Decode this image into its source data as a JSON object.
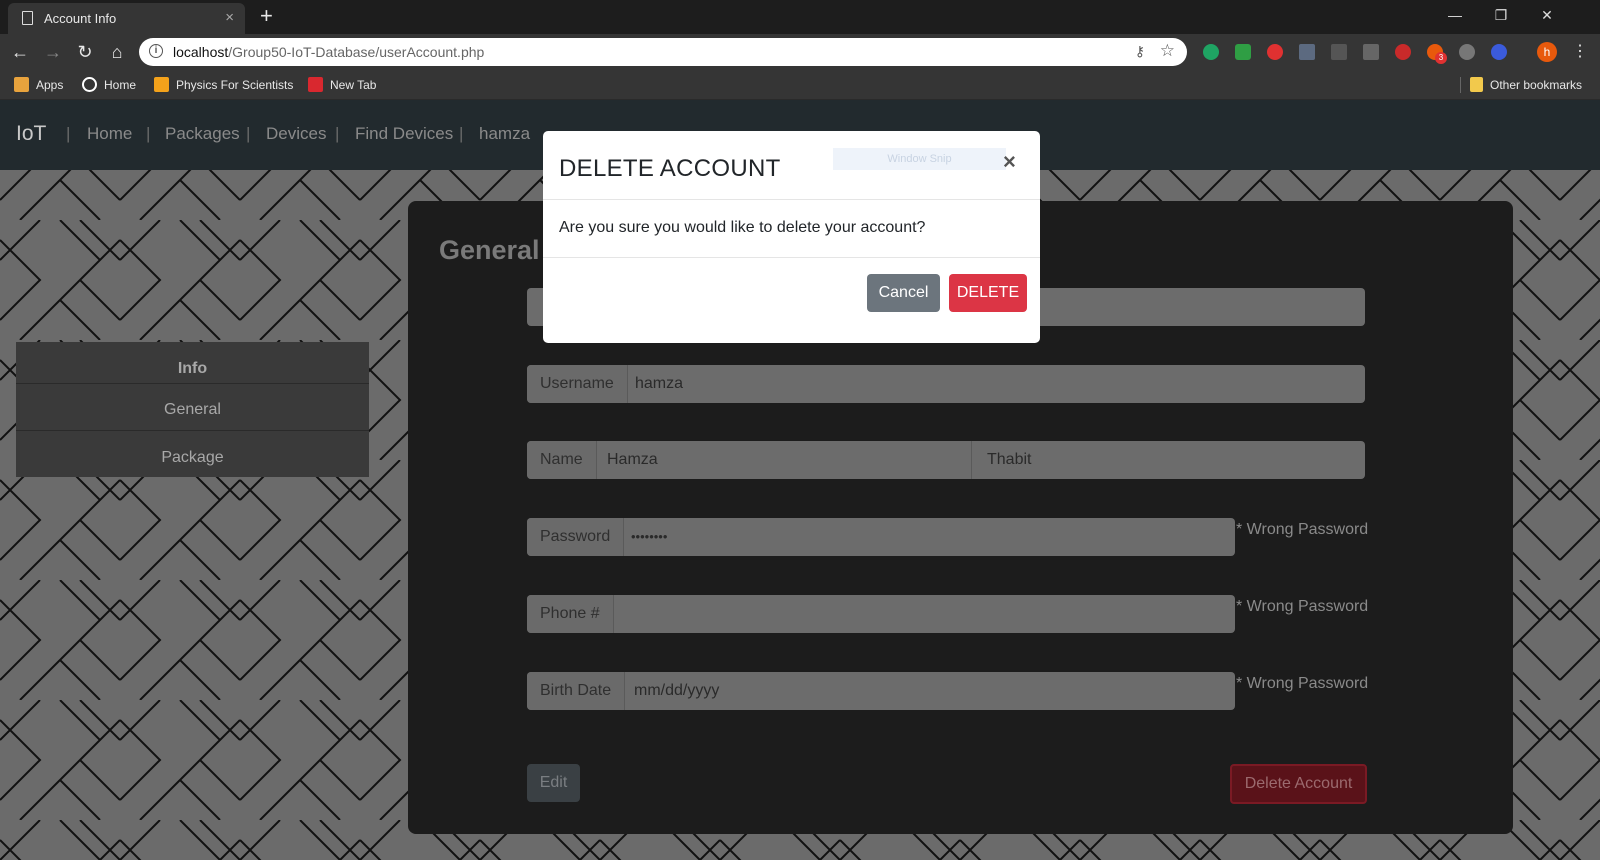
{
  "browser": {
    "tab_title": "Account Info",
    "tab_close": "×",
    "new_tab": "+",
    "url_host": "localhost",
    "url_path": "/Group50-IoT-Database/userAccount.php",
    "bookmarks": [
      {
        "label": "Apps",
        "color": "#e8a33d"
      },
      {
        "label": "Home",
        "color": "#ffffff"
      },
      {
        "label": "Physics For Scientists",
        "color": "#f4a21b"
      },
      {
        "label": "New Tab",
        "color": "#d9282f"
      }
    ],
    "other_bookmarks": "Other bookmarks",
    "ext_badge": "3",
    "profile_initial": "h"
  },
  "navbar": {
    "brand": "IoT",
    "links": [
      "Home",
      "Packages",
      "Devices",
      "Find Devices",
      "hamza"
    ]
  },
  "sidebar": {
    "header": "Info",
    "items": [
      "General",
      "Package"
    ]
  },
  "panel": {
    "title": "General",
    "fields": {
      "username_label": "Username",
      "username_value": "hamza",
      "name_label": "Name",
      "first_name": "Hamza",
      "last_name": "Thabit",
      "password_label": "Password",
      "password_value": "••••••••",
      "phone_label": "Phone #",
      "birth_label": "Birth Date",
      "birth_placeholder": "mm/dd/yyyy"
    },
    "errors": [
      "* Wrong Password",
      "* Wrong Password",
      "* Wrong Password"
    ],
    "edit_label": "Edit",
    "delete_account_label": "Delete Account"
  },
  "modal": {
    "title": "DELETE ACCOUNT",
    "snip_label": "Window Snip",
    "close": "×",
    "body": "Are you sure you would like to delete your account?",
    "cancel_label": "Cancel",
    "delete_label": "DELETE"
  },
  "colors": {
    "danger": "#dc3545",
    "secondary": "#6c757d"
  }
}
